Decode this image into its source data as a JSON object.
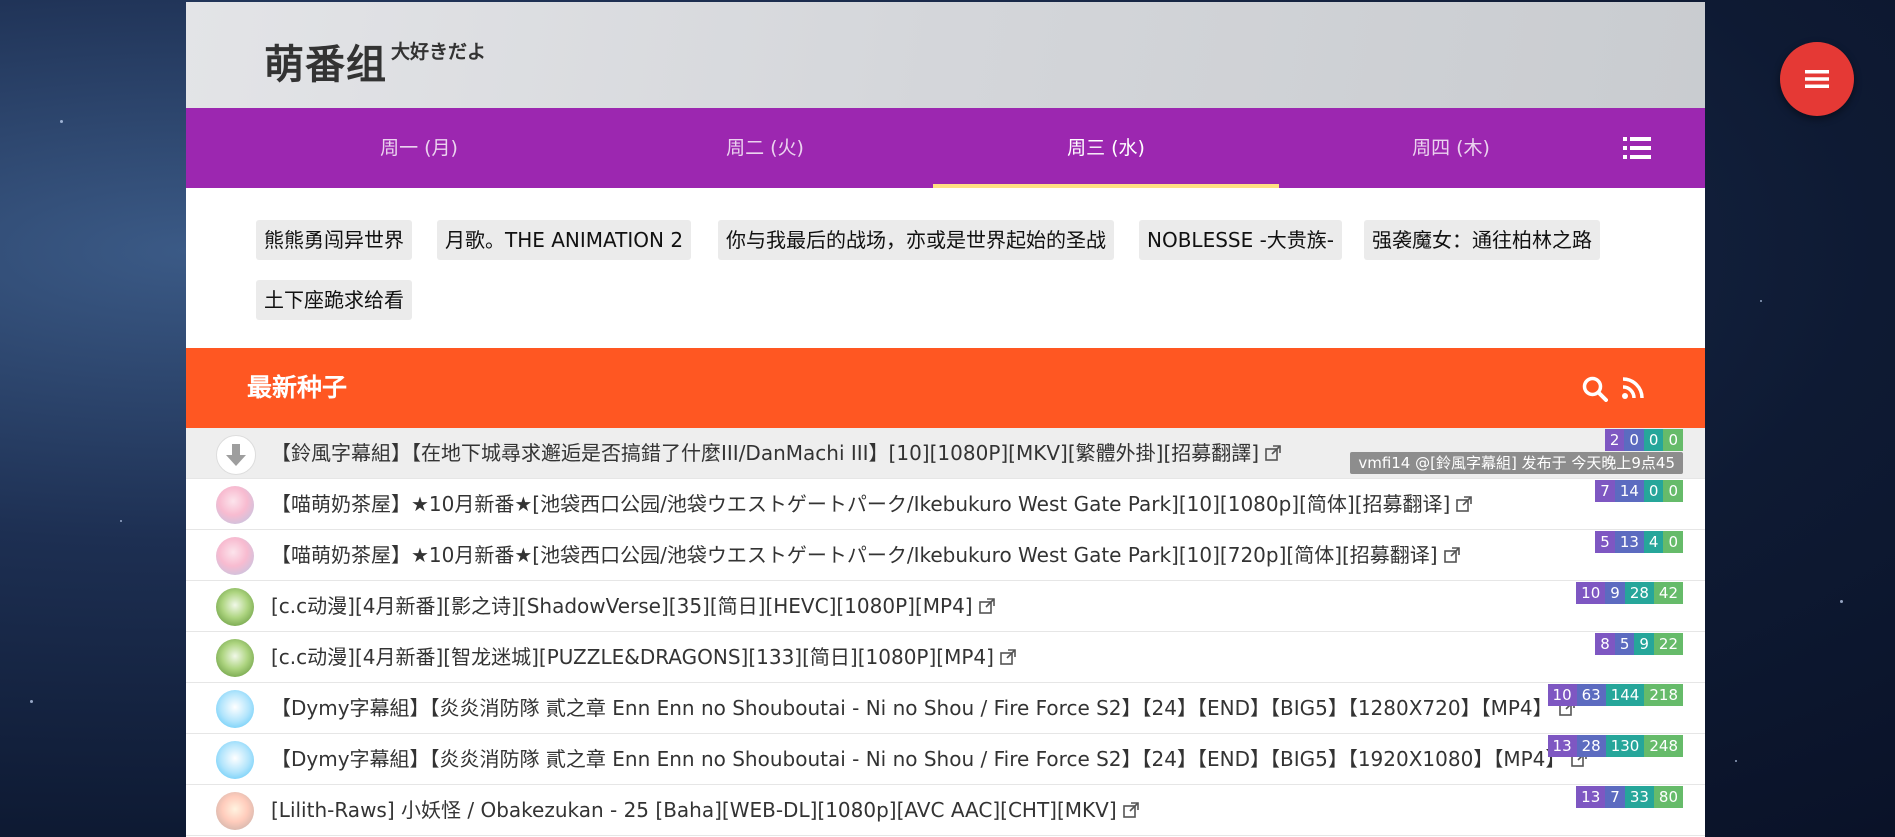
{
  "brand": {
    "name": "萌番组",
    "tagline": "大好きだよ"
  },
  "tabs": [
    {
      "label": "周一 (月)"
    },
    {
      "label": "周二 (火)"
    },
    {
      "label": "周三 (水)"
    },
    {
      "label": "周四 (木)"
    }
  ],
  "active_tab": 2,
  "anime": [
    "熊熊勇闯异世界",
    "月歌。THE ANIMATION 2",
    "你与我最后的战场，亦或是世界起始的圣战",
    "NOBLESSE -大贵族-",
    "强袭魔女：通往柏林之路",
    "土下座跪求给看"
  ],
  "seed_section": {
    "title": "最新种子"
  },
  "torrents": [
    {
      "title": "【鈴風字幕組】【在地下城尋求邂逅是否搞錯了什麼III/DanMachi III】[10][1080P][MKV][繁體外掛][招募翻譯]",
      "stats": [
        "2",
        "0",
        "0",
        "0"
      ],
      "avatar": "download-icon",
      "tooltip": "vmfi14 @[鈴風字幕組] 发布于 今天晚上9点45"
    },
    {
      "title": "【喵萌奶茶屋】★10月新番★[池袋西口公园/池袋ウエストゲートパーク/Ikebukuro West Gate Park][10][1080p][简体][招募翻译]",
      "stats": [
        "7",
        "14",
        "0",
        "0"
      ],
      "avatar": "pink-avatar"
    },
    {
      "title": "【喵萌奶茶屋】★10月新番★[池袋西口公园/池袋ウエストゲートパーク/Ikebukuro West Gate Park][10][720p][简体][招募翻译]",
      "stats": [
        "5",
        "13",
        "4",
        "0"
      ],
      "avatar": "pink-avatar"
    },
    {
      "title": "[c.c动漫][4月新番][影之诗][ShadowVerse][35][简日][HEVC][1080P][MP4]",
      "stats": [
        "10",
        "9",
        "28",
        "42"
      ],
      "avatar": "green-avatar"
    },
    {
      "title": "[c.c动漫][4月新番][智龙迷城][PUZZLE&DRAGONS][133][简日][1080P][MP4]",
      "stats": [
        "8",
        "5",
        "9",
        "22"
      ],
      "avatar": "green-avatar"
    },
    {
      "title": "【Dymy字幕組】【炎炎消防隊 貳之章 Enn Enn no Shouboutai - Ni no Shou / Fire Force S2】【24】【END】【BIG5】【1280X720】【MP4】",
      "stats": [
        "10",
        "63",
        "144",
        "218"
      ],
      "avatar": "blue-avatar"
    },
    {
      "title": "【Dymy字幕組】【炎炎消防隊 貳之章 Enn Enn no Shouboutai - Ni no Shou / Fire Force S2】【24】【END】【BIG5】【1920X1080】【MP4】",
      "stats": [
        "13",
        "28",
        "130",
        "248"
      ],
      "avatar": "blue-avatar"
    },
    {
      "title": "[Lilith-Raws] 小妖怪 / Obakezukan - 25 [Baha][WEB-DL][1080p][AVC AAC][CHT][MKV]",
      "stats": [
        "13",
        "7",
        "33",
        "80"
      ],
      "avatar": "peach-avatar"
    }
  ],
  "colors": {
    "nav": "#9c27b0",
    "seed_bar": "#ff5722",
    "fab": "#e53935",
    "tab_indicator": "#ffe082"
  }
}
